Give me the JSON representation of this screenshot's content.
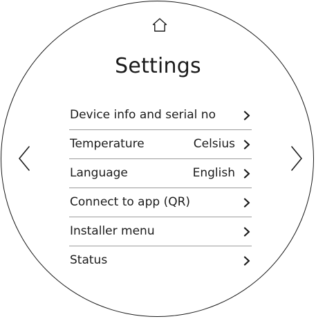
{
  "header": {
    "home_icon": "home-icon",
    "title": "Settings"
  },
  "navigation": {
    "previous_icon": "chevron-left-icon",
    "next_icon": "chevron-right-icon"
  },
  "menu": {
    "items": [
      {
        "label": "Device info and serial no",
        "value": ""
      },
      {
        "label": "Temperature",
        "value": "Celsius"
      },
      {
        "label": "Language",
        "value": "English"
      },
      {
        "label": "Connect to app (QR)",
        "value": ""
      },
      {
        "label": "Installer menu",
        "value": ""
      },
      {
        "label": "Status",
        "value": ""
      }
    ],
    "item_icon": "chevron-right-icon"
  },
  "colors": {
    "foreground": "#1a1a1a",
    "divider": "#9a9a9a",
    "background": "#ffffff"
  }
}
